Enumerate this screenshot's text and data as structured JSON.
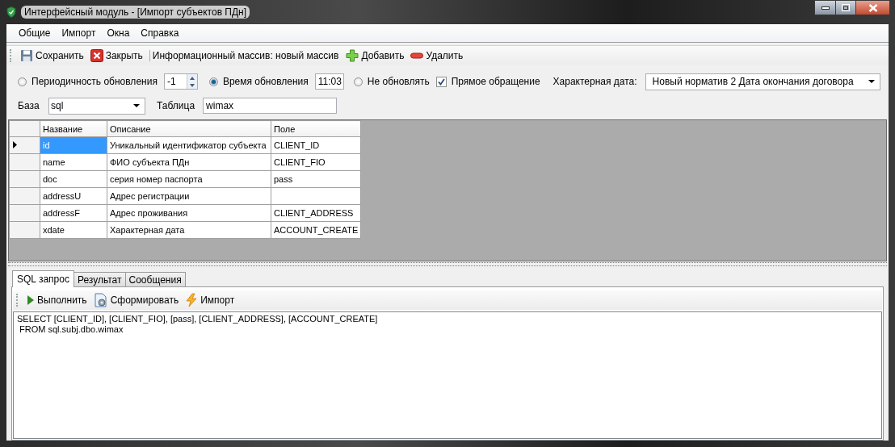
{
  "window": {
    "title": "Интерфейсный модуль - [Импорт субъектов ПДн]"
  },
  "menu": [
    "Общие",
    "Импорт",
    "Окна",
    "Справка"
  ],
  "toolbar": [
    {
      "kind": "save",
      "label": "Сохранить"
    },
    {
      "kind": "close",
      "label": "Закрыть"
    },
    {
      "kind": "text",
      "label": "Информационный массив: новый массив"
    },
    {
      "kind": "add",
      "label": "Добавить"
    },
    {
      "kind": "remove",
      "label": "Удалить"
    }
  ],
  "update_modes": [
    {
      "kind": "spinner",
      "label": "Периодичность обновления",
      "selected": false,
      "value": "-1"
    },
    {
      "kind": "time",
      "label": "Время обновления",
      "selected": true,
      "value": "11:03"
    },
    {
      "kind": "plain",
      "label": "Не обновлять",
      "selected": false
    }
  ],
  "direct_access": {
    "label": "Прямое обращение",
    "checked": true
  },
  "date": {
    "label": "Характерная дата:",
    "value": "Новый норматив 2 Дата окончания договора"
  },
  "base": {
    "label": "База",
    "value": "sql"
  },
  "table_name": {
    "label": "Таблица",
    "value": "wimax"
  },
  "grid": {
    "columns": [
      "Название",
      "Описание",
      "Поле"
    ],
    "rows": [
      {
        "current": true,
        "cells": [
          {
            "text": "id",
            "selected": true
          },
          {
            "text": "Уникальный идентификатор субъекта",
            "selected": false
          },
          {
            "text": "CLIENT_ID",
            "selected": false
          }
        ]
      },
      {
        "current": false,
        "cells": [
          {
            "text": "name",
            "selected": false
          },
          {
            "text": "ФИО субъекта ПДн",
            "selected": false
          },
          {
            "text": "CLIENT_FIO",
            "selected": false
          }
        ]
      },
      {
        "current": false,
        "cells": [
          {
            "text": "doc",
            "selected": false
          },
          {
            "text": "серия номер паспорта",
            "selected": false
          },
          {
            "text": "pass",
            "selected": false
          }
        ]
      },
      {
        "current": false,
        "cells": [
          {
            "text": "addressU",
            "selected": false
          },
          {
            "text": "Адрес регистрации",
            "selected": false
          },
          {
            "selected": false
          }
        ]
      },
      {
        "current": false,
        "cells": [
          {
            "text": "addressF",
            "selected": false
          },
          {
            "text": "Адрес проживания",
            "selected": false
          },
          {
            "text": "CLIENT_ADDRESS",
            "selected": false
          }
        ]
      },
      {
        "current": false,
        "cells": [
          {
            "text": "xdate",
            "selected": false
          },
          {
            "text": "Характерная дата",
            "selected": false
          },
          {
            "text": "ACCOUNT_CREATE",
            "selected": false
          }
        ]
      }
    ]
  },
  "bottom_tabs": [
    {
      "label": "SQL запрос",
      "selected": true
    },
    {
      "label": "Результат",
      "selected": false
    },
    {
      "label": "Сообщения",
      "selected": false
    }
  ],
  "query_toolbar": [
    {
      "kind": "run",
      "label": "Выполнить"
    },
    {
      "kind": "build",
      "label": "Сформировать"
    },
    {
      "kind": "import",
      "label": "Импорт"
    }
  ],
  "sql": [
    "SELECT [CLIENT_ID], [CLIENT_FIO], [pass], [CLIENT_ADDRESS], [ACCOUNT_CREATE]",
    " FROM sql.subj.dbo.wimax"
  ]
}
